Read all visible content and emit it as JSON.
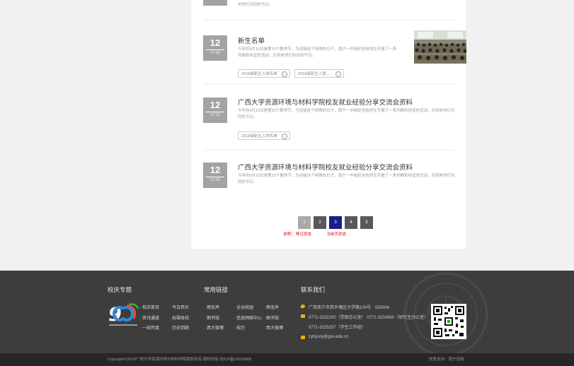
{
  "items": [
    {
      "desc_tail": "老师们共同的节日。"
    },
    {
      "day": "12",
      "month": "17-12",
      "title": "新生名单",
      "desc": "今年的9月10日是第33个教师节，为迎接这个特殊的日子，南宁一中组织全校师生开展了一系列精彩纷呈的活动，庆祝老师们共同的节日。",
      "tags": [
        "2018级新生入党名单",
        "2018级新生入党..."
      ]
    },
    {
      "day": "12",
      "month": "17-12",
      "title": "广西大学资源环境与材料学院校友就业经验分享交流会资料",
      "desc": "今年的9月10日是第33个教师节，为迎接这个特殊的日子，南宁一中组织全校师生开展了一系列精彩纷呈的活动，庆祝老师们共同的节日。",
      "tags": [
        "2018级新生入党名单"
      ]
    },
    {
      "day": "12",
      "month": "17-12",
      "title": "广西大学资源环境与材料学院校友就业经验分享交流会资料",
      "desc": "今年的9月10日是第33个教师节，为迎接这个特殊的日子，南宁一中组织全校师生开展了一系列精彩纷呈的活动，庆祝老师们共同的节日。"
    }
  ],
  "pagination": {
    "pages": [
      "1",
      "2",
      "3",
      "4",
      "5"
    ],
    "current": 3,
    "hover": 1
  },
  "legend": {
    "note": "说明：",
    "hover_label": "移过状态",
    "current_label": "当前页状态"
  },
  "footer": {
    "col1_title": "校庆专题",
    "col1_links": [
      "校庆首页",
      "今日西大",
      "资讯通道",
      "祝福母校",
      "一线传真",
      "历史回顾"
    ],
    "col2_title": "常用链接",
    "col2_links": [
      "雨无声",
      "全谷校园",
      "雨无声",
      "图书馆",
      "信息网络中心",
      "图书馆",
      "西大微博",
      "校历",
      "西大微博"
    ],
    "col3_title": "联系我们",
    "address": "广西南宁市西乡塘区大学路100号　530004",
    "phone1": "0771-3232200（党政办公室） 0771-3234560（研究生办公室）",
    "phone2": "0771-3225257（学生工作组）",
    "email": "zyhjcxly@gxu.edu.cn"
  },
  "copyright": "Copyright©2018广西大学资源环境与材料学院版权所有 版权所有 桂ICP备16018888",
  "tech_support": "创意支持：南宁冠网",
  "colors": {
    "date_bg": "#a3a3a3",
    "page_current": "#1c1c8c",
    "page_hover": "#a9a9a9",
    "page_default": "#595959",
    "legend_red": "#e50000",
    "footer_bg": "#3d3d3d",
    "bottom_bg": "#262626"
  }
}
